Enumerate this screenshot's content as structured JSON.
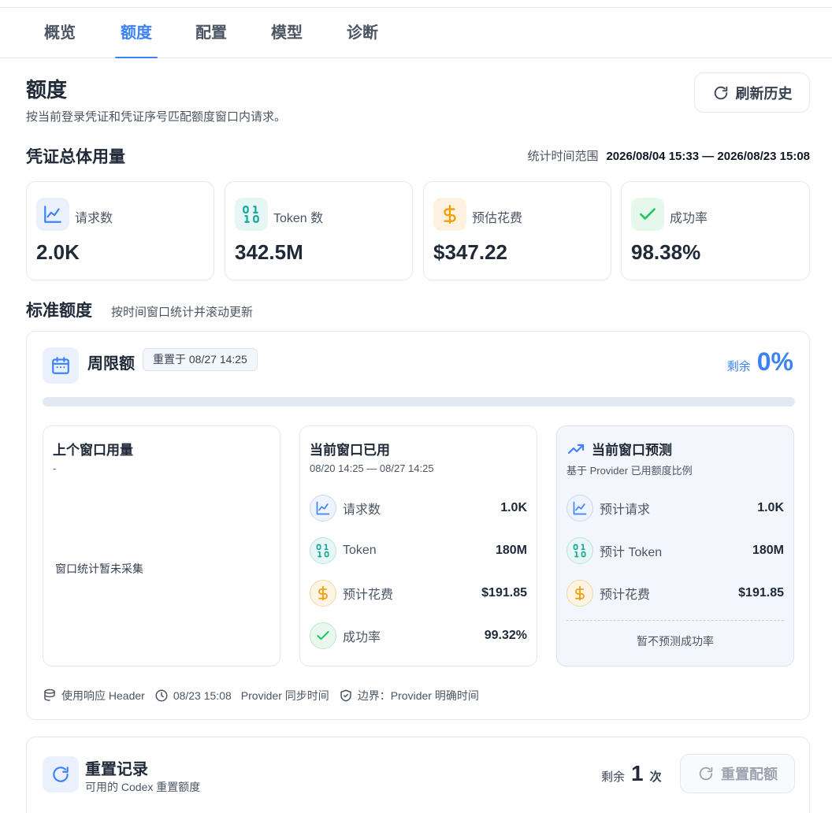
{
  "tabs": [
    {
      "label": "概览",
      "active": false
    },
    {
      "label": "额度",
      "active": true
    },
    {
      "label": "配置",
      "active": false
    },
    {
      "label": "模型",
      "active": false
    },
    {
      "label": "诊断",
      "active": false
    }
  ],
  "header": {
    "title": "额度",
    "subtitle": "按当前登录凭证和凭证序号匹配额度窗口内请求。",
    "refresh_label": "刷新历史"
  },
  "usage": {
    "title": "凭证总体用量",
    "range_label": "统计时间范围",
    "range_value": "2026/08/04 15:33 — 2026/08/23 15:08",
    "stats": [
      {
        "icon": "line-chart-icon",
        "label": "请求数",
        "value": "2.0K"
      },
      {
        "icon": "binary-icon",
        "label": "Token 数",
        "value": "342.5M"
      },
      {
        "icon": "dollar-icon",
        "label": "预估花费",
        "value": "$347.22"
      },
      {
        "icon": "check-icon",
        "label": "成功率",
        "value": "98.38%"
      }
    ]
  },
  "standard": {
    "title": "标准额度",
    "subtitle": "按时间窗口统计并滚动更新",
    "card": {
      "title": "周限额",
      "reset_badge": "重置于 08/27 14:25",
      "remain_label": "剩余",
      "remain_value": "0%",
      "used_fraction": 0,
      "previous": {
        "title": "上个窗口用量",
        "subtitle": "-",
        "empty_text": "窗口统计暂未采集"
      },
      "current": {
        "title": "当前窗口已用",
        "subtitle": "08/20 14:25 — 08/27 14:25",
        "rows": [
          {
            "label": "请求数",
            "value": "1.0K"
          },
          {
            "label": "Token",
            "value": "180M"
          },
          {
            "label": "预计花费",
            "value": "$191.85"
          },
          {
            "label": "成功率",
            "value": "99.32%"
          }
        ]
      },
      "forecast": {
        "title": "当前窗口预测",
        "subtitle": "基于 Provider 已用额度比例",
        "rows": [
          {
            "label": "预计请求",
            "value": "1.0K"
          },
          {
            "label": "预计 Token",
            "value": "180M"
          },
          {
            "label": "预计花费",
            "value": "$191.85"
          }
        ],
        "note": "暂不预测成功率"
      },
      "footer": {
        "source": "使用响应 Header",
        "time": "08/23 15:08",
        "sync_label": "Provider 同步时间",
        "boundary": "边界：Provider 明确时间"
      }
    }
  },
  "reset": {
    "title": "重置记录",
    "subtitle": "可用的 Codex 重置额度",
    "remain_label": "剩余",
    "remain_value": "1",
    "remain_unit": "次",
    "button_label": "重置配额"
  },
  "colors": {
    "accent": "#3b82f6",
    "teal": "#14a89a",
    "amber": "#f59e0b",
    "green": "#22c55e"
  }
}
